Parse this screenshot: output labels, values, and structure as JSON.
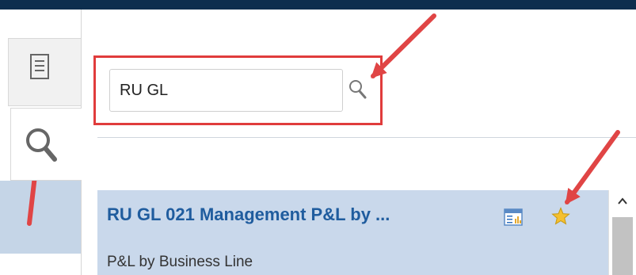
{
  "search": {
    "value": "RU GL"
  },
  "results": [
    {
      "title": "RU GL 021 Management P&L by ...",
      "subtitle": "P&L by Business Line"
    }
  ],
  "icons": {
    "doc_tab": "document-icon",
    "search_tab": "magnifier-icon",
    "search_button": "magnifier-icon",
    "report_type": "report-icon",
    "favorite": "star-icon",
    "scroll_up": "chevron-up-icon"
  },
  "colors": {
    "topbar": "#0d2e4e",
    "highlight_box": "#e03c3c",
    "selected_row": "#c9d8eb",
    "title_link": "#1f5c9e",
    "star": "#f5c02f",
    "annotation_arrow": "#e04545"
  }
}
